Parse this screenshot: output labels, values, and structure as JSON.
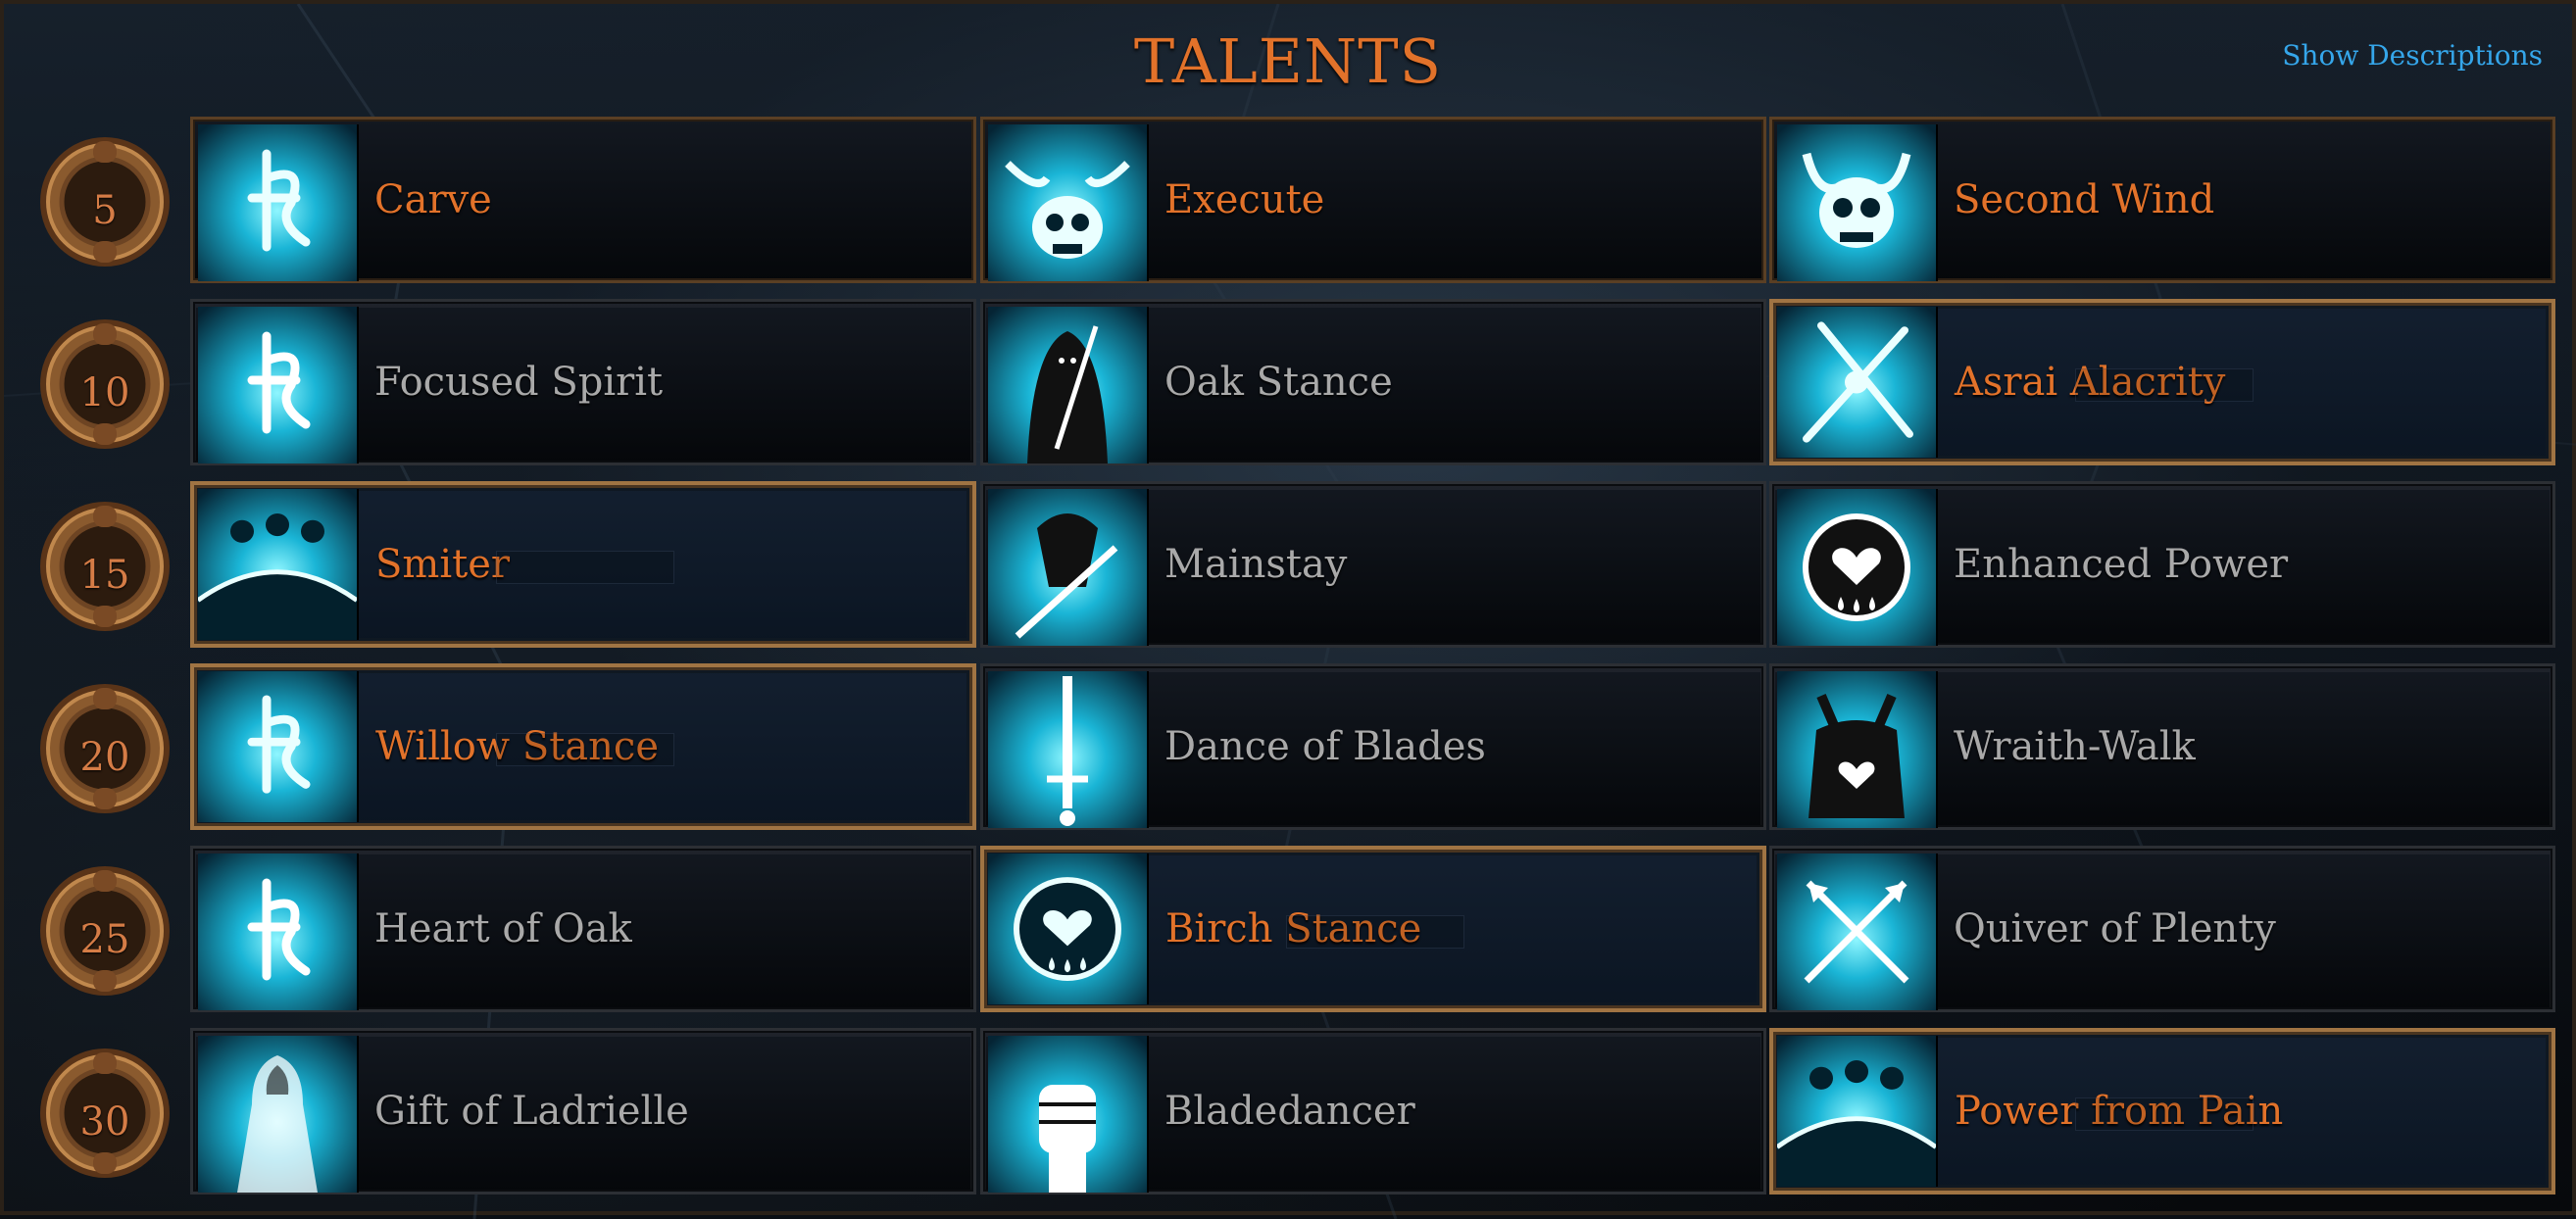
{
  "title": "TALENTS",
  "show_descriptions": "Show Descriptions",
  "colors": {
    "accent": "#e2722a",
    "link": "#35a6ea",
    "inactive_text": "#a9a9a9",
    "frame_gold": "#a07443"
  },
  "tiers": [
    "5",
    "10",
    "15",
    "20",
    "25",
    "30"
  ],
  "talents": [
    [
      {
        "name": "Carve",
        "icon": "rune-icon",
        "state": "learned"
      },
      {
        "name": "Execute",
        "icon": "winged-skull-icon",
        "state": "learned"
      },
      {
        "name": "Second Wind",
        "icon": "horned-skull-icon",
        "state": "learned"
      }
    ],
    [
      {
        "name": "Focused Spirit",
        "icon": "rune-icon",
        "state": "locked"
      },
      {
        "name": "Oak Stance",
        "icon": "hooded-figure-icon",
        "state": "locked"
      },
      {
        "name": "Asrai Alacrity",
        "icon": "crossed-swords-icon",
        "state": "selected"
      }
    ],
    [
      {
        "name": "Smiter",
        "icon": "horizon-figures-icon",
        "state": "selected"
      },
      {
        "name": "Mainstay",
        "icon": "sword-warrior-icon",
        "state": "locked"
      },
      {
        "name": "Enhanced Power",
        "icon": "heart-orb-icon",
        "state": "locked"
      }
    ],
    [
      {
        "name": "Willow Stance",
        "icon": "rune-icon",
        "state": "selected"
      },
      {
        "name": "Dance of Blades",
        "icon": "upright-sword-icon",
        "state": "locked"
      },
      {
        "name": "Wraith-Walk",
        "icon": "horned-wraith-icon",
        "state": "locked"
      }
    ],
    [
      {
        "name": "Heart of Oak",
        "icon": "rune-icon",
        "state": "locked"
      },
      {
        "name": "Birch Stance",
        "icon": "heart-orb-icon",
        "state": "selected"
      },
      {
        "name": "Quiver of Plenty",
        "icon": "crossed-arrows-icon",
        "state": "locked"
      }
    ],
    [
      {
        "name": "Gift of Ladrielle",
        "icon": "ghost-figure-icon",
        "state": "locked"
      },
      {
        "name": "Bladedancer",
        "icon": "fist-icon",
        "state": "locked"
      },
      {
        "name": "Power from Pain",
        "icon": "horizon-figures-icon",
        "state": "selected"
      }
    ]
  ]
}
